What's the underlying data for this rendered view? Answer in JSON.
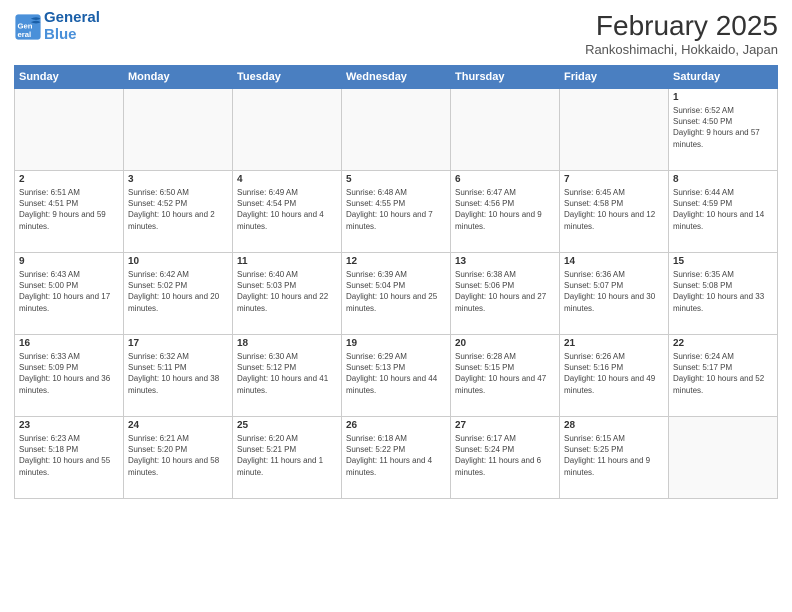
{
  "logo": {
    "line1": "General",
    "line2": "Blue"
  },
  "title": "February 2025",
  "subtitle": "Rankoshimachi, Hokkaido, Japan",
  "headers": [
    "Sunday",
    "Monday",
    "Tuesday",
    "Wednesday",
    "Thursday",
    "Friday",
    "Saturday"
  ],
  "weeks": [
    [
      {
        "num": "",
        "info": ""
      },
      {
        "num": "",
        "info": ""
      },
      {
        "num": "",
        "info": ""
      },
      {
        "num": "",
        "info": ""
      },
      {
        "num": "",
        "info": ""
      },
      {
        "num": "",
        "info": ""
      },
      {
        "num": "1",
        "info": "Sunrise: 6:52 AM\nSunset: 4:50 PM\nDaylight: 9 hours and 57 minutes."
      }
    ],
    [
      {
        "num": "2",
        "info": "Sunrise: 6:51 AM\nSunset: 4:51 PM\nDaylight: 9 hours and 59 minutes."
      },
      {
        "num": "3",
        "info": "Sunrise: 6:50 AM\nSunset: 4:52 PM\nDaylight: 10 hours and 2 minutes."
      },
      {
        "num": "4",
        "info": "Sunrise: 6:49 AM\nSunset: 4:54 PM\nDaylight: 10 hours and 4 minutes."
      },
      {
        "num": "5",
        "info": "Sunrise: 6:48 AM\nSunset: 4:55 PM\nDaylight: 10 hours and 7 minutes."
      },
      {
        "num": "6",
        "info": "Sunrise: 6:47 AM\nSunset: 4:56 PM\nDaylight: 10 hours and 9 minutes."
      },
      {
        "num": "7",
        "info": "Sunrise: 6:45 AM\nSunset: 4:58 PM\nDaylight: 10 hours and 12 minutes."
      },
      {
        "num": "8",
        "info": "Sunrise: 6:44 AM\nSunset: 4:59 PM\nDaylight: 10 hours and 14 minutes."
      }
    ],
    [
      {
        "num": "9",
        "info": "Sunrise: 6:43 AM\nSunset: 5:00 PM\nDaylight: 10 hours and 17 minutes."
      },
      {
        "num": "10",
        "info": "Sunrise: 6:42 AM\nSunset: 5:02 PM\nDaylight: 10 hours and 20 minutes."
      },
      {
        "num": "11",
        "info": "Sunrise: 6:40 AM\nSunset: 5:03 PM\nDaylight: 10 hours and 22 minutes."
      },
      {
        "num": "12",
        "info": "Sunrise: 6:39 AM\nSunset: 5:04 PM\nDaylight: 10 hours and 25 minutes."
      },
      {
        "num": "13",
        "info": "Sunrise: 6:38 AM\nSunset: 5:06 PM\nDaylight: 10 hours and 27 minutes."
      },
      {
        "num": "14",
        "info": "Sunrise: 6:36 AM\nSunset: 5:07 PM\nDaylight: 10 hours and 30 minutes."
      },
      {
        "num": "15",
        "info": "Sunrise: 6:35 AM\nSunset: 5:08 PM\nDaylight: 10 hours and 33 minutes."
      }
    ],
    [
      {
        "num": "16",
        "info": "Sunrise: 6:33 AM\nSunset: 5:09 PM\nDaylight: 10 hours and 36 minutes."
      },
      {
        "num": "17",
        "info": "Sunrise: 6:32 AM\nSunset: 5:11 PM\nDaylight: 10 hours and 38 minutes."
      },
      {
        "num": "18",
        "info": "Sunrise: 6:30 AM\nSunset: 5:12 PM\nDaylight: 10 hours and 41 minutes."
      },
      {
        "num": "19",
        "info": "Sunrise: 6:29 AM\nSunset: 5:13 PM\nDaylight: 10 hours and 44 minutes."
      },
      {
        "num": "20",
        "info": "Sunrise: 6:28 AM\nSunset: 5:15 PM\nDaylight: 10 hours and 47 minutes."
      },
      {
        "num": "21",
        "info": "Sunrise: 6:26 AM\nSunset: 5:16 PM\nDaylight: 10 hours and 49 minutes."
      },
      {
        "num": "22",
        "info": "Sunrise: 6:24 AM\nSunset: 5:17 PM\nDaylight: 10 hours and 52 minutes."
      }
    ],
    [
      {
        "num": "23",
        "info": "Sunrise: 6:23 AM\nSunset: 5:18 PM\nDaylight: 10 hours and 55 minutes."
      },
      {
        "num": "24",
        "info": "Sunrise: 6:21 AM\nSunset: 5:20 PM\nDaylight: 10 hours and 58 minutes."
      },
      {
        "num": "25",
        "info": "Sunrise: 6:20 AM\nSunset: 5:21 PM\nDaylight: 11 hours and 1 minute."
      },
      {
        "num": "26",
        "info": "Sunrise: 6:18 AM\nSunset: 5:22 PM\nDaylight: 11 hours and 4 minutes."
      },
      {
        "num": "27",
        "info": "Sunrise: 6:17 AM\nSunset: 5:24 PM\nDaylight: 11 hours and 6 minutes."
      },
      {
        "num": "28",
        "info": "Sunrise: 6:15 AM\nSunset: 5:25 PM\nDaylight: 11 hours and 9 minutes."
      },
      {
        "num": "",
        "info": ""
      }
    ]
  ]
}
